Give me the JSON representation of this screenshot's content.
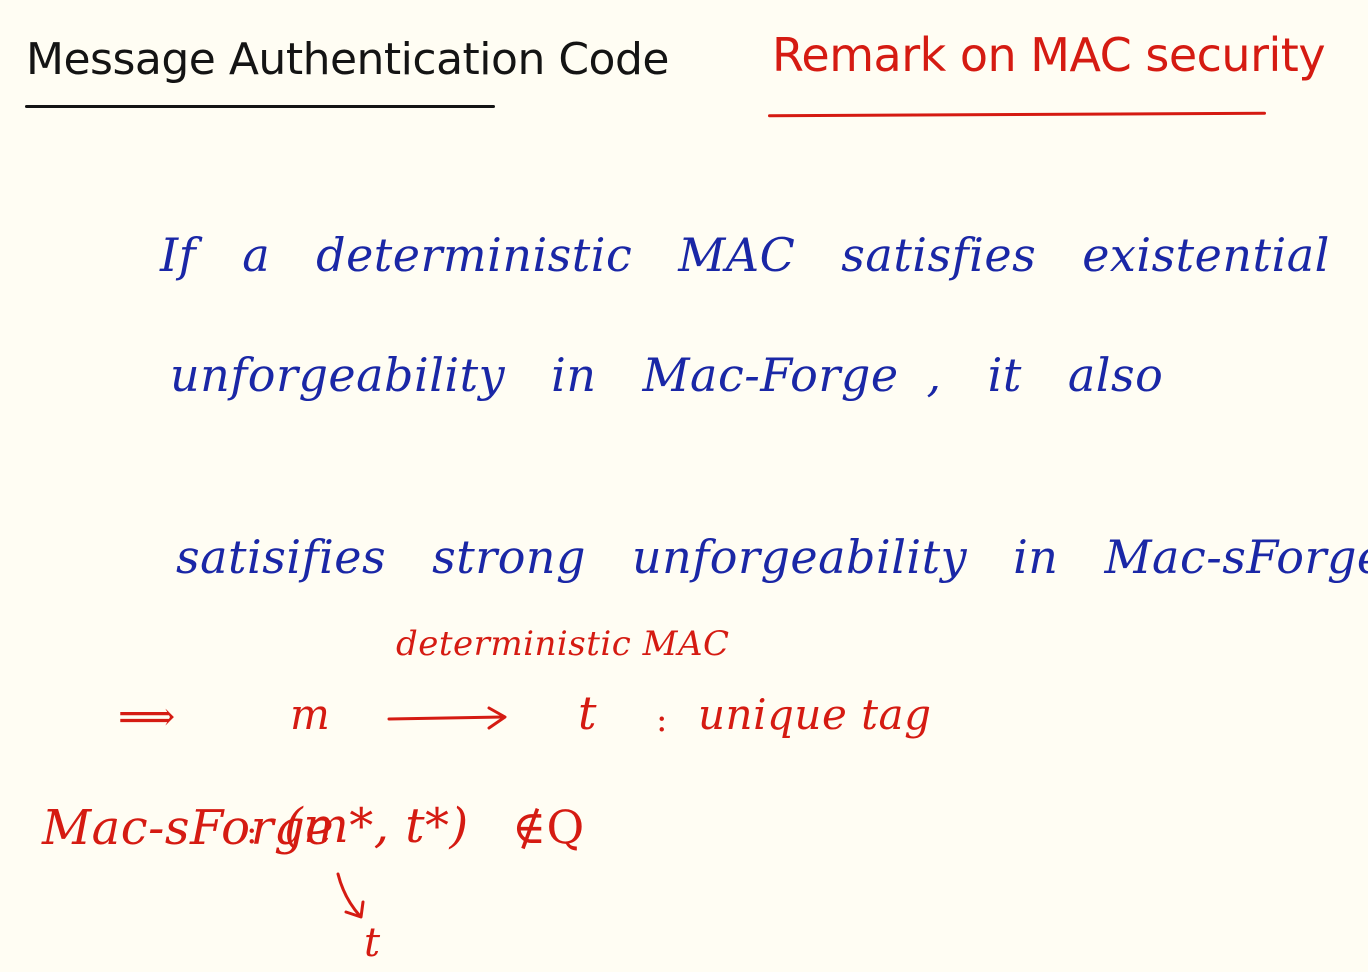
{
  "header": {
    "left_title": "Message Authentication Code",
    "right_title": "Remark on MAC security"
  },
  "statement": {
    "line1": [
      "If",
      "a",
      "deterministic",
      "MAC",
      "satisfies",
      "existential"
    ],
    "line2": [
      "unforgeability",
      "in",
      "Mac-Forge",
      ",",
      "it",
      "also"
    ],
    "line3": [
      "satisifies",
      "strong",
      "unforgeability",
      "in",
      "Mac-sForge."
    ]
  },
  "derivation": {
    "implies": "⟹",
    "message": "m",
    "arrow_label": "deterministic MAC",
    "tag": "t",
    "colon": ":",
    "tag_note": "unique tag"
  },
  "sforge": {
    "label": "Mac-sForge",
    "colon": ":",
    "pair": "(m*, t*)",
    "not_in": "∉Q",
    "below": "t"
  },
  "colors": {
    "background": "#fffdf3",
    "black_ink": "#141414",
    "blue_ink": "#1a27a6",
    "red_ink": "#d51b12"
  }
}
